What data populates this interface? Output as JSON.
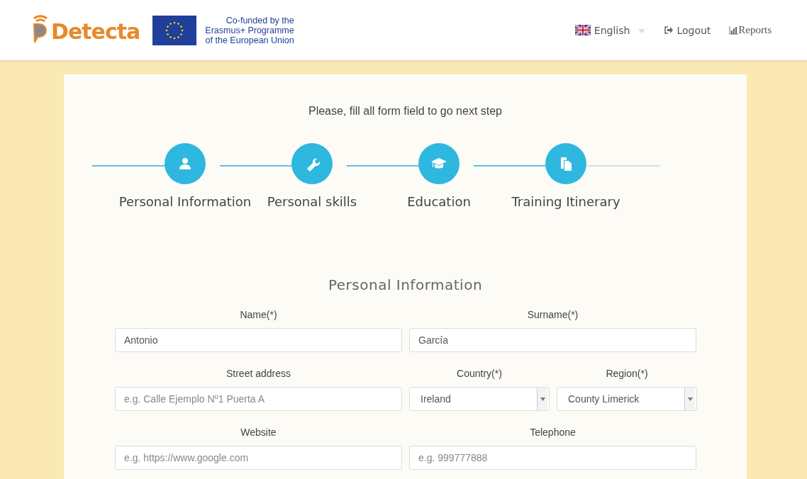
{
  "header": {
    "logo": "Detecta",
    "eu_text": [
      "Co-funded by the",
      "Erasmus+ Programme",
      "of the European Union"
    ],
    "language": "English",
    "logout": "Logout",
    "reports": "Reports"
  },
  "instruction": "Please, fill all form field to go next step",
  "steps": [
    {
      "label": "Personal Information"
    },
    {
      "label": "Personal skills"
    },
    {
      "label": "Education"
    },
    {
      "label": "Training Itinerary"
    }
  ],
  "section_title": "Personal Information",
  "rows": [
    [
      {
        "kind": "input",
        "label": "Name(*)",
        "value": "Antonio"
      },
      {
        "kind": "input",
        "label": "Surname(*)",
        "value": "García"
      }
    ],
    [
      {
        "kind": "input",
        "label": "Street address",
        "placeholder": "e.g. Calle Ejemplo Nº1 Puerta A"
      },
      {
        "kind": "select",
        "label": "Country(*)",
        "value": "Ireland"
      },
      {
        "kind": "select",
        "label": "Region(*)",
        "value": "County Limerick"
      }
    ],
    [
      {
        "kind": "input",
        "label": "Website",
        "placeholder": "e.g. https://www.google.com"
      },
      {
        "kind": "input",
        "label": "Telephone",
        "placeholder": "e.g. 999777888"
      }
    ]
  ]
}
